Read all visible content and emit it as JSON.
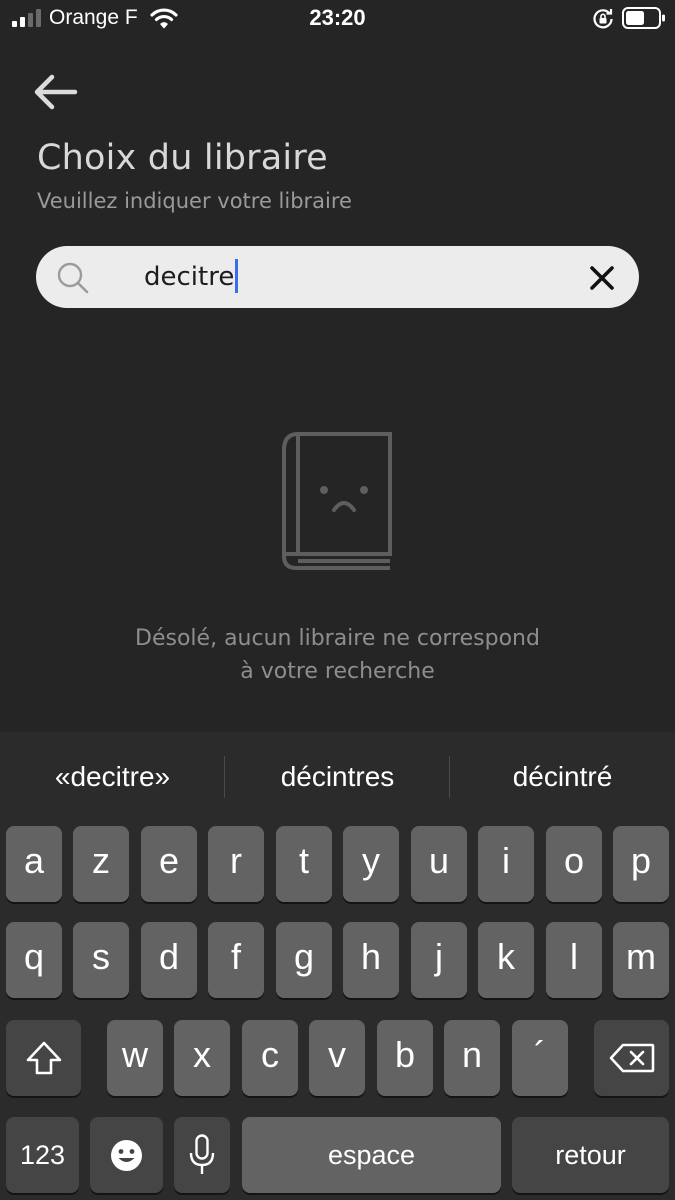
{
  "status_bar": {
    "carrier": "Orange F",
    "time": "23:20",
    "icons": [
      "signal-icon",
      "wifi-icon",
      "rotation-lock-icon",
      "battery-icon"
    ]
  },
  "header": {
    "back_icon": "arrow-left-icon",
    "title": "Choix du libraire",
    "subtitle": "Veuillez indiquer votre libraire"
  },
  "search": {
    "value": "decitre",
    "icons": [
      "search-icon",
      "close-icon"
    ]
  },
  "empty_state": {
    "icon": "sad-book-icon",
    "line1": "Désolé, aucun libraire ne correspond",
    "line2": "à votre recherche"
  },
  "keyboard": {
    "suggestions": [
      "«decitre»",
      "décintres",
      "décintré"
    ],
    "row1": [
      "a",
      "z",
      "e",
      "r",
      "t",
      "y",
      "u",
      "i",
      "o",
      "p"
    ],
    "row2": [
      "q",
      "s",
      "d",
      "f",
      "g",
      "h",
      "j",
      "k",
      "l",
      "m"
    ],
    "row3": [
      "w",
      "x",
      "c",
      "v",
      "b",
      "n",
      "´"
    ],
    "numbers_label": "123",
    "space_label": "espace",
    "return_label": "retour",
    "icons": [
      "shift-icon",
      "backspace-icon",
      "emoji-icon",
      "microphone-icon"
    ]
  },
  "colors": {
    "background": "#252525",
    "search_background": "#ececec",
    "caret": "#3a6ee8",
    "key": "#636363",
    "function_key": "#454545"
  }
}
